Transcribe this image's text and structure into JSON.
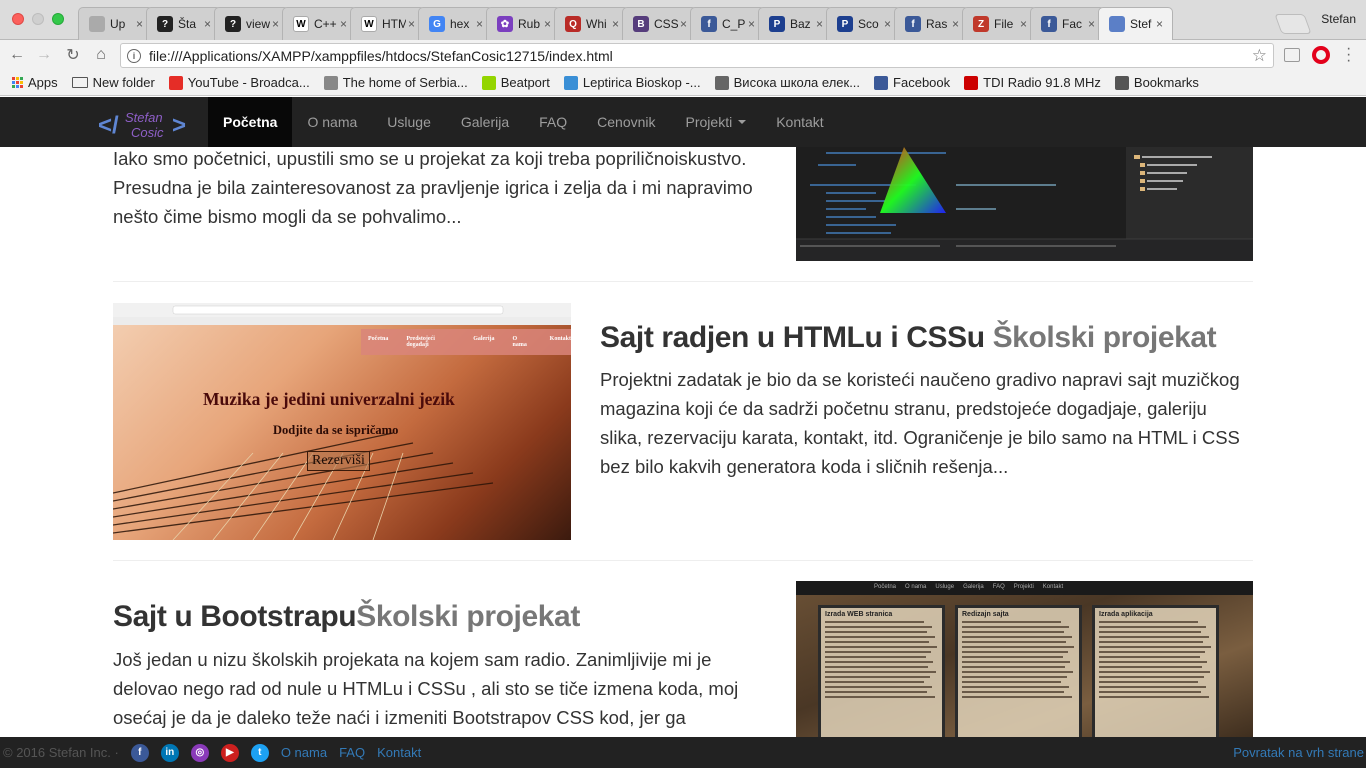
{
  "browser": {
    "tabs": [
      {
        "label": "Up",
        "fav_text": "",
        "fav_color": "#aaaaaa"
      },
      {
        "label": "Šta",
        "fav_text": "?",
        "fav_color": "#222222"
      },
      {
        "label": "view",
        "fav_text": "?",
        "fav_color": "#222222"
      },
      {
        "label": "C++",
        "fav_text": "W",
        "fav_color": "#ffffff"
      },
      {
        "label": "HTM",
        "fav_text": "W",
        "fav_color": "#ffffff"
      },
      {
        "label": "hex",
        "fav_text": "G",
        "fav_color": "#4285f4"
      },
      {
        "label": "Rub",
        "fav_text": "✿",
        "fav_color": "#7b3fbf"
      },
      {
        "label": "Whi",
        "fav_text": "Q",
        "fav_color": "#b92b27"
      },
      {
        "label": "CSS",
        "fav_text": "B",
        "fav_color": "#563d7c"
      },
      {
        "label": "C_P",
        "fav_text": "f",
        "fav_color": "#3b5998"
      },
      {
        "label": "Baz",
        "fav_text": "P",
        "fav_color": "#1d3f8f"
      },
      {
        "label": "Sco",
        "fav_text": "P",
        "fav_color": "#1d3f8f"
      },
      {
        "label": "Ras",
        "fav_text": "f",
        "fav_color": "#3b5998"
      },
      {
        "label": "File",
        "fav_text": "Z",
        "fav_color": "#c0392b"
      },
      {
        "label": "Fac",
        "fav_text": "f",
        "fav_color": "#3b5998"
      },
      {
        "label": "Stef",
        "fav_text": "",
        "fav_color": "#5b7fc7"
      }
    ],
    "profile": "Stefan",
    "url": "file:///Applications/XAMPP/xamppfiles/htdocs/StefanCosic12715/index.html",
    "bookmarks": [
      {
        "label": "Apps",
        "icon": "apps-grid-icon"
      },
      {
        "label": "New folder",
        "icon": "folder-icon"
      },
      {
        "label": "YouTube - Broadca...",
        "icon": "youtube-icon",
        "color": "#e52d27"
      },
      {
        "label": "The home of Serbia...",
        "icon": "page-icon",
        "color": "#888888"
      },
      {
        "label": "Beatport",
        "icon": "beatport-icon",
        "color": "#94d500"
      },
      {
        "label": "Leptirica Bioskop -...",
        "icon": "butterfly-icon",
        "color": "#3a8fd6"
      },
      {
        "label": "Висока школа елек...",
        "icon": "wave-icon",
        "color": "#666666"
      },
      {
        "label": "Facebook",
        "icon": "facebook-icon",
        "color": "#3b5998"
      },
      {
        "label": "TDI Radio 91.8 MHz",
        "icon": "tdi-icon",
        "color": "#cc0000"
      },
      {
        "label": "Bookmarks",
        "icon": "star-icon",
        "color": "#555555"
      }
    ]
  },
  "site": {
    "logo_text": "Stefan Cosic",
    "nav": [
      "Početna",
      "O nama",
      "Usluge",
      "Galerija",
      "FAQ",
      "Cenovnik",
      "Projekti",
      "Kontakt"
    ],
    "p1": "Iako smo početnici, upustili smo se u projekat za koji treba popriličnoiskustvo. Presudna je bila zainteresovanost za pravljenje igrica i zelja da i mi napravimo nešto čime bismo mogli da se pohvalimo...",
    "h2a_main": "Sajt radjen u HTMLu i CSSu ",
    "h2a_muted": "Školski projekat",
    "p2": "Projektni zadatak je bio da se koristeći naučeno gradivo napravi sajt muzičkog magazina koji će da sadrži početnu stranu, predstojeće dogadjaje, galeriju slika, rezervaciju karata, kontakt, itd. Ograničenje je bilo samo na HTML i CSS bez bilo kakvih generatora koda i sličnih rešenja...",
    "h2b_main": "Sajt u Bootstrapu",
    "h2b_muted": "Školski projekat",
    "p3": "Još jedan u nizu školskih projekata na kojem sam radio. Zanimljivije mi je delovao nego rad od nule u HTMLu i CSSu , ali sto se tiče izmena koda, moj osećaj je da je daleko teže naći i izmeniti Bootstrapov CSS kod, jer ga",
    "shot2": {
      "heading": "Muzika je jedini univerzalni jezik",
      "sub": "Dodjite da se ispričamo",
      "button": "Rezerviši",
      "menu": [
        "Početna",
        "Predstojeći događaji",
        "Galerija",
        "O nama",
        "Kontakt"
      ]
    },
    "shot3": {
      "menu": [
        "Početna",
        "O nama",
        "Usluge",
        "Galerija",
        "FAQ",
        "Projekti",
        "Kontakt"
      ],
      "cards": [
        "Izrada WEB stranica",
        "Redizajn sajta",
        "Izrada aplikacija"
      ]
    },
    "footer": {
      "copyright": "© 2016 Stefan Inc. ·",
      "links": [
        "O nama",
        "FAQ",
        "Kontakt"
      ],
      "back_to_top": "Povratak na vrh strane"
    }
  }
}
